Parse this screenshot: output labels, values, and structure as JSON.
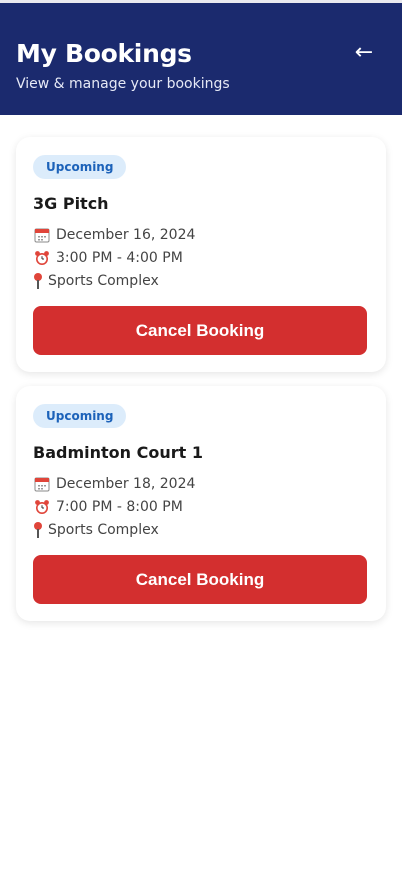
{
  "header": {
    "title": "My Bookings",
    "subtitle": "View & manage your bookings",
    "back_icon": "left-arrow-icon",
    "background": "#1b2a6e"
  },
  "bookings": [
    {
      "status": "Upcoming",
      "venue": "3G Pitch",
      "date": "December 16, 2024",
      "time": "3:00 PM - 4:00 PM",
      "location": "Sports Complex",
      "cancel_label": "Cancel Booking"
    },
    {
      "status": "Upcoming",
      "venue": "Badminton Court 1",
      "date": "December 18, 2024",
      "time": "7:00 PM - 8:00 PM",
      "location": "Sports Complex",
      "cancel_label": "Cancel Booking"
    }
  ],
  "colors": {
    "accent": "#1b2a6e",
    "danger": "#d32f2f",
    "badge_bg": "#dcecfb",
    "badge_text": "#1c62b9"
  },
  "icons": {
    "date": "calendar-icon",
    "time": "alarm-clock-icon",
    "location": "map-pin-icon"
  }
}
